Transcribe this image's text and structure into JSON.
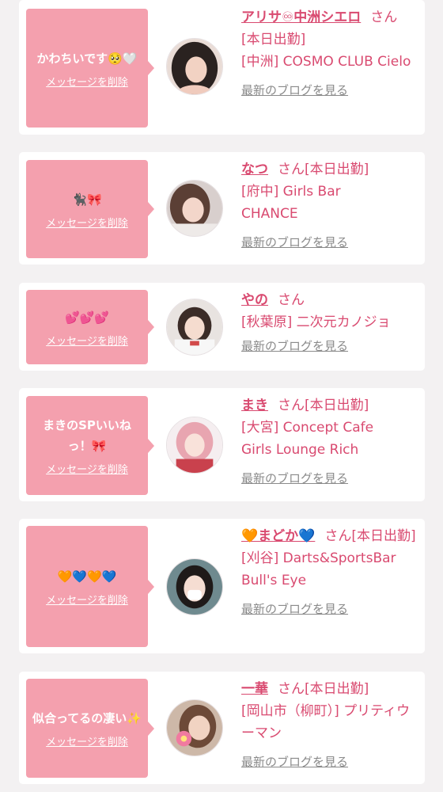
{
  "common": {
    "delete_label": "メッセージを削除",
    "blog_label": "最新のブログを見る",
    "honorific": "さん"
  },
  "colors": {
    "bubble": "#f4a0ae",
    "accent_text": "#d94a70",
    "link_gray": "#8a8a8a",
    "page_bg": "#f3f1f2"
  },
  "cards": [
    {
      "message": "かわちいです🥺🤍",
      "name": "アリサ♾中洲シエロ",
      "status": "[本日出勤]",
      "shop": "[中洲] COSMO CLUB Cielo"
    },
    {
      "message": "🐈‍⬛🎀",
      "name": "なつ",
      "status": "[本日出勤]",
      "shop": "[府中] Girls Bar CHANCE"
    },
    {
      "message": "💕💕💕",
      "name": "やの",
      "status": "",
      "shop": "[秋葉原] 二次元カノジョ"
    },
    {
      "message": "まきのSPいいねっ！🎀",
      "name": "まき",
      "status": "[本日出勤]",
      "shop": "[大宮] Concept Cafe Girls Lounge Rich"
    },
    {
      "message": "🧡💙🧡💙",
      "name": "🧡まどか💙",
      "status": "[本日出勤]",
      "shop": "[刈谷] Darts&SportsBar Bull's Eye"
    },
    {
      "message": "似合ってるの凄い✨",
      "name": "一華",
      "status": "[本日出勤]",
      "shop": "[岡山市（柳町）] プリティウーマン"
    }
  ]
}
